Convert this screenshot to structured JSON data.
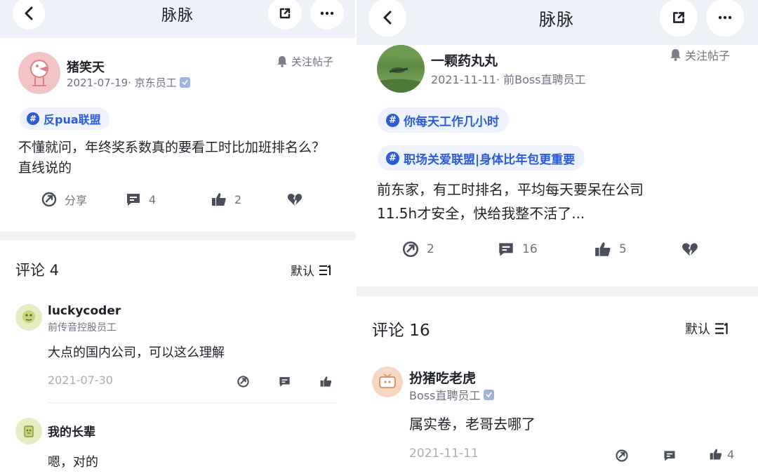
{
  "left": {
    "title": "脉脉",
    "post": {
      "author": "猪笑天",
      "meta": "2021-07-19· 京东员工",
      "follow_label": "关注帖子",
      "tag": "反pua联盟",
      "content": "不懂就问，年终奖系数真的要看工时比加班排名么？直线说的",
      "share_label": "分享",
      "comment_count": "4",
      "like_count": "2"
    },
    "comments_title": "评论 4",
    "sort_label": "默认",
    "comments": [
      {
        "author": "luckycoder",
        "sub": "前传音控股员工",
        "text": "大点的国内公司，可以这么理解",
        "date": "2021-07-30"
      },
      {
        "author": "我的长辈",
        "text": "嗯，对的"
      }
    ]
  },
  "right": {
    "title": "脉脉",
    "post": {
      "author": "一颗药丸丸",
      "meta": "2021-11-11· 前Boss直聘员工",
      "follow_label": "关注帖子",
      "tags": [
        "你每天工作几小时",
        "职场关爱联盟|身体比年包更重要"
      ],
      "content_line1": "前东家，有工时排名，平均每天要呆在公司",
      "content_line2": "11.5h才安全，快给我整不活了...",
      "share_count": "2",
      "comment_count": "16",
      "like_count": "5"
    },
    "comments_title": "评论 16",
    "sort_label": "默认",
    "comments": [
      {
        "author": "扮猪吃老虎",
        "sub": "Boss直聘员工",
        "text": "属实卷，老哥去哪了",
        "date": "2021-11-11",
        "like_count": "4"
      }
    ]
  },
  "colors": {
    "accent": "#2b5bd7",
    "tag_bg": "#edf2fd",
    "topbar": "#eef1f7",
    "muted": "#6e7380"
  }
}
